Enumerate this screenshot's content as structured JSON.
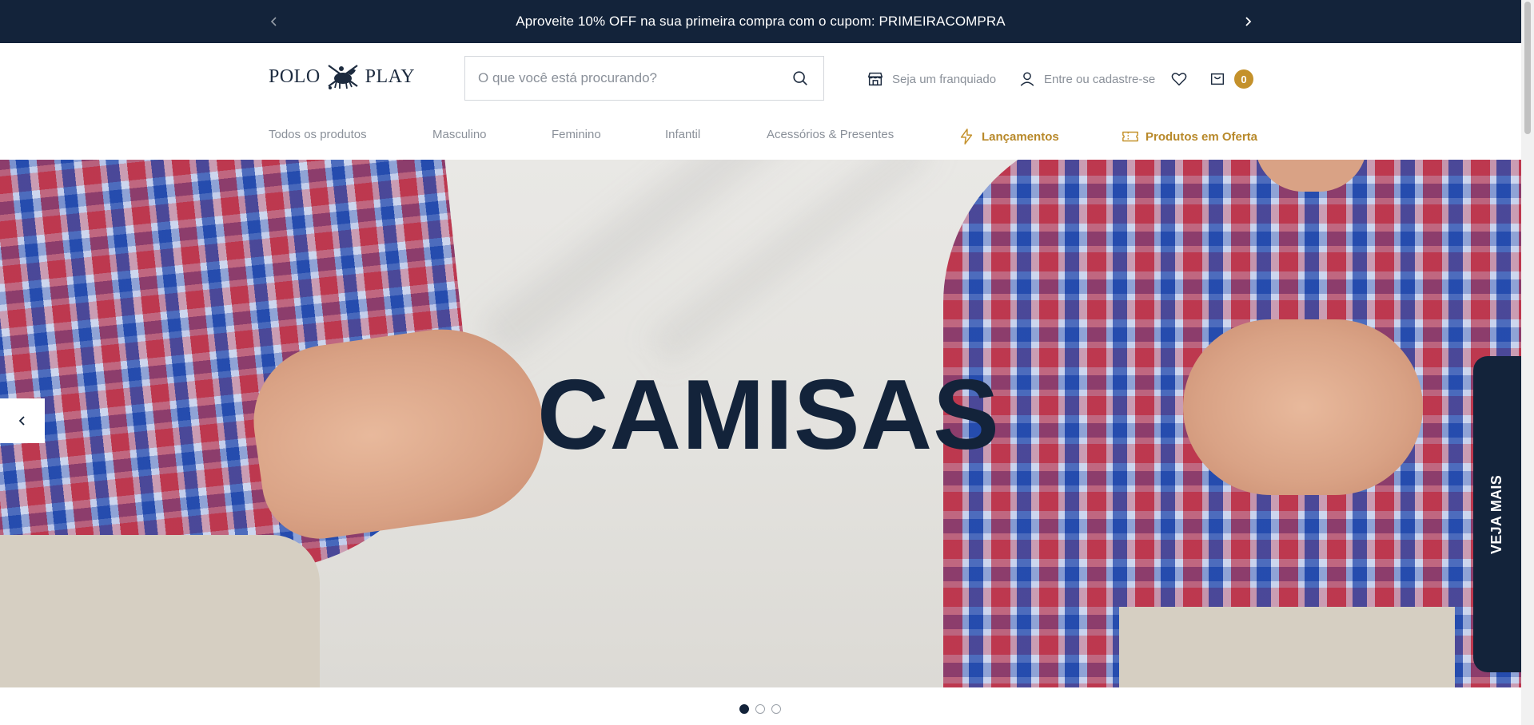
{
  "promo": {
    "text": "Aproveite 10% OFF na sua primeira compra com o cupom: PRIMEIRACOMPRA",
    "prev_icon": "chevron-left-icon",
    "next_icon": "chevron-right-icon"
  },
  "header": {
    "logo_left": "POLO",
    "logo_right": "PLAY",
    "search": {
      "placeholder": "O que você está procurando?",
      "value": ""
    },
    "franchise_label": "Seja um franquiado",
    "account_label": "Entre ou cadastre-se",
    "cart_count": "0"
  },
  "nav": {
    "items": [
      {
        "label": "Todos os produtos"
      },
      {
        "label": "Masculino"
      },
      {
        "label": "Feminino"
      },
      {
        "label": "Infantil"
      },
      {
        "label": "Acessórios & Presentes"
      },
      {
        "label": "Lançamentos",
        "icon": "lightning-icon"
      },
      {
        "label": "Produtos em Oferta",
        "icon": "ticket-icon"
      }
    ]
  },
  "hero": {
    "headline": "CAMISAS",
    "side_tab": "VEJA MAIS",
    "slides": 3,
    "active_slide": 1
  },
  "colors": {
    "navy": "#13233a",
    "gold": "#c4912b",
    "gold_text": "#b8892a",
    "muted": "#8a9099"
  }
}
